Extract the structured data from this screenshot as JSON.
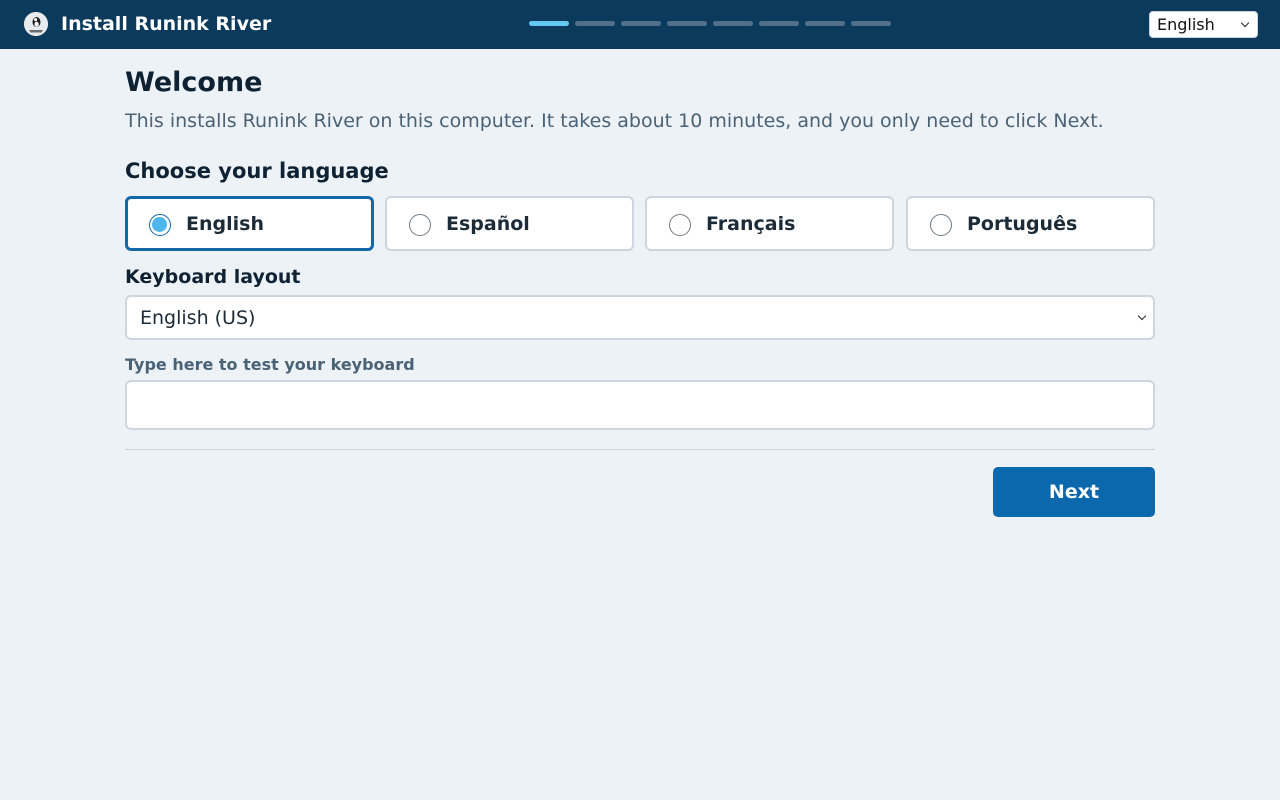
{
  "header": {
    "app_title": "Install Runink River",
    "logo_icon": "runink-river-logo-icon",
    "progress": {
      "current_step": 1,
      "total_steps": 8
    },
    "language_select": {
      "value": "English"
    }
  },
  "main": {
    "title": "Welcome",
    "intro": "This installs Runink River on this computer. It takes about 10 minutes, and you only need to click Next.",
    "language_section": {
      "title": "Choose your language",
      "options": [
        {
          "label": "English",
          "selected": true
        },
        {
          "label": "Español",
          "selected": false
        },
        {
          "label": "Français",
          "selected": false
        },
        {
          "label": "Português",
          "selected": false
        }
      ]
    },
    "keyboard": {
      "label": "Keyboard layout",
      "value": "English (US)",
      "test_label": "Type here to test your keyboard",
      "test_value": ""
    },
    "next_label": "Next"
  },
  "colors": {
    "header_bg": "#0b3a5c",
    "page_bg": "#edf2f7",
    "accent": "#0c68ad",
    "active_step": "#63c8f2",
    "radio_fill": "#4eb6ec"
  }
}
